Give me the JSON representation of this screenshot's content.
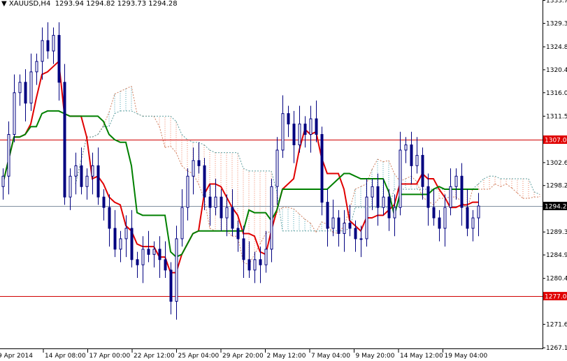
{
  "header": {
    "symbol": "XAUUSD,H4",
    "ohlc": "1293.94 1294.82 1293.73 1294.28"
  },
  "colors": {
    "bull": "#000080",
    "bear": "#000080",
    "tenkan": "#e00000",
    "kijun": "#008000",
    "cloud_up": "#f08060",
    "cloud_down": "#40a0b0",
    "level": "#d00000",
    "price": "#000000"
  },
  "chart_data": {
    "type": "candlestick",
    "title": "XAUUSD,H4",
    "ylim": [
      1267.1,
      1333.7
    ],
    "y_ticks": [
      "1333.70",
      "1329.30",
      "1324.80",
      "1320.40",
      "1316.00",
      "1311.50",
      "1302.60",
      "1298.20",
      "1289.30",
      "1284.90",
      "1280.40",
      "1271.60",
      "1267.10"
    ],
    "x_labels": [
      "9 Apr 2014",
      "14 Apr 08:00",
      "17 Apr 00:00",
      "22 Apr 12:00",
      "25 Apr 04:00",
      "29 Apr 20:00",
      "2 May 12:00",
      "7 May 04:00",
      "9 May 20:00",
      "14 May 12:00",
      "19 May 04:00"
    ],
    "close": [
      1300,
      1308,
      1316,
      1318,
      1314,
      1320,
      1322,
      1326,
      1324,
      1327,
      1318,
      1296,
      1300,
      1302,
      1298,
      1300,
      1302,
      1296,
      1294,
      1290,
      1286,
      1288,
      1290,
      1284,
      1283,
      1286,
      1285,
      1286,
      1284,
      1282,
      1276,
      1288,
      1294,
      1300,
      1303,
      1302,
      1296,
      1294,
      1296,
      1292,
      1294,
      1290,
      1288,
      1284,
      1282,
      1284,
      1283,
      1286,
      1298,
      1305,
      1312,
      1310,
      1306,
      1310,
      1308,
      1311,
      1308,
      1295,
      1290,
      1292,
      1289,
      1291,
      1290,
      1288,
      1288,
      1296,
      1298,
      1294,
      1296,
      1292,
      1294,
      1305,
      1306,
      1302,
      1304,
      1298,
      1294,
      1292,
      1290,
      1294,
      1298,
      1300,
      1294,
      1290,
      1292,
      1294.28
    ],
    "horizontal_levels": [
      {
        "label": "1307.00",
        "value": 1307.0
      },
      {
        "label": "1277.00",
        "value": 1277.0
      }
    ],
    "current_price": {
      "label": "1294.28",
      "value": 1294.28
    },
    "indicator": "Ichimoku"
  }
}
